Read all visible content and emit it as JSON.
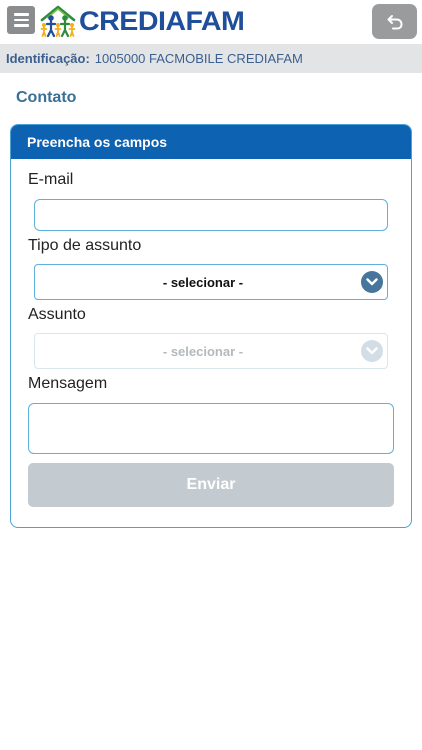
{
  "header": {
    "brand_name": "CREDIAFAM",
    "menu_icon": "hamburger-menu-icon",
    "back_icon": "undo-arrow-icon",
    "brand_color": "#1f4e9a"
  },
  "identification": {
    "label": "Identificação:",
    "value": "1005000 FACMOBILE CREDIAFAM"
  },
  "page": {
    "title": "Contato"
  },
  "form": {
    "header": "Preencha os campos",
    "email_label": "E-mail",
    "email_value": "",
    "subject_type_label": "Tipo de assunto",
    "subject_type_value": "- selecionar -",
    "subject_label": "Assunto",
    "subject_value": "- selecionar -",
    "subject_enabled": false,
    "message_label": "Mensagem",
    "message_value": "",
    "submit_label": "Enviar",
    "submit_enabled": false
  },
  "colors": {
    "panel_header_bg": "#0d62b1",
    "panel_border": "#4aa2d6",
    "chevron_active": "#47759c",
    "submit_disabled": "#c4cbd0"
  }
}
